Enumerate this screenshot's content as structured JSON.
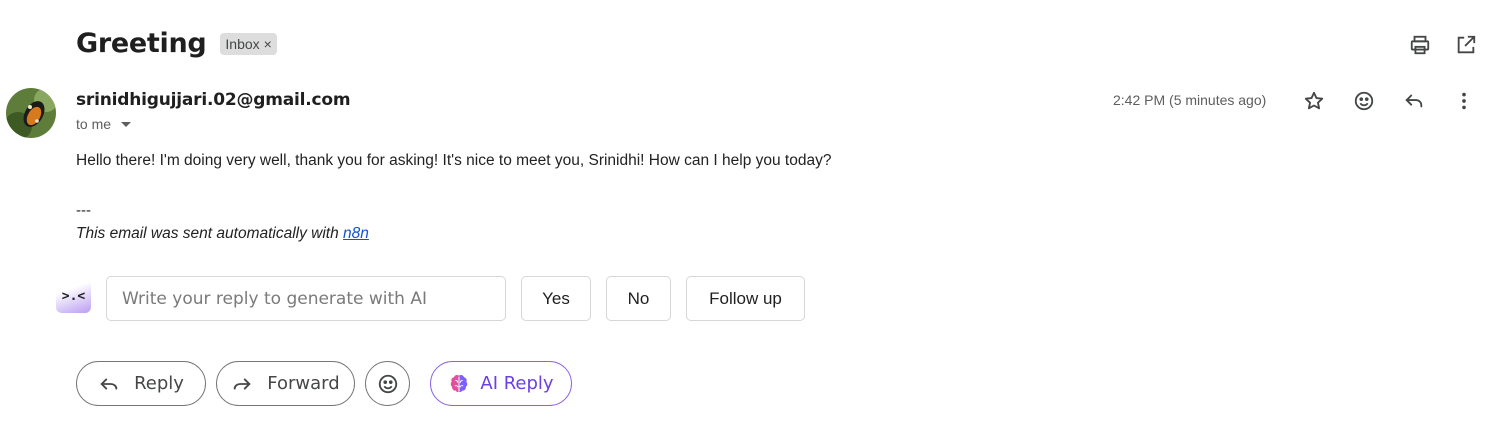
{
  "email": {
    "subject": "Greeting",
    "label": "Inbox",
    "label_remove": "×",
    "sender": "srinidhigujjari.02@gmail.com",
    "recipient": "to me",
    "time": "2:42 PM (5 minutes ago)",
    "body": "Hello there! I'm doing very well, thank you for asking! It's nice to meet you, Srinidhi! How can I help you today?",
    "signature_separator": "---",
    "signature_text": "This email was sent automatically with ",
    "signature_link": "n8n"
  },
  "ai_reply": {
    "logo_text": ">.<",
    "placeholder": "Write your reply to generate with AI",
    "suggestions": [
      "Yes",
      "No",
      "Follow up"
    ]
  },
  "actions": {
    "reply": "Reply",
    "forward": "Forward",
    "ai_reply": "AI Reply"
  },
  "icons": {
    "top": [
      "print-icon",
      "open-in-new-window-icon"
    ],
    "message": [
      "star-icon",
      "emoji-reaction-icon",
      "reply-icon",
      "more-options-icon"
    ]
  },
  "colors": {
    "link": "#1155cc",
    "ai_accent": "#6b3fe0",
    "label_bg": "#dddddd"
  }
}
